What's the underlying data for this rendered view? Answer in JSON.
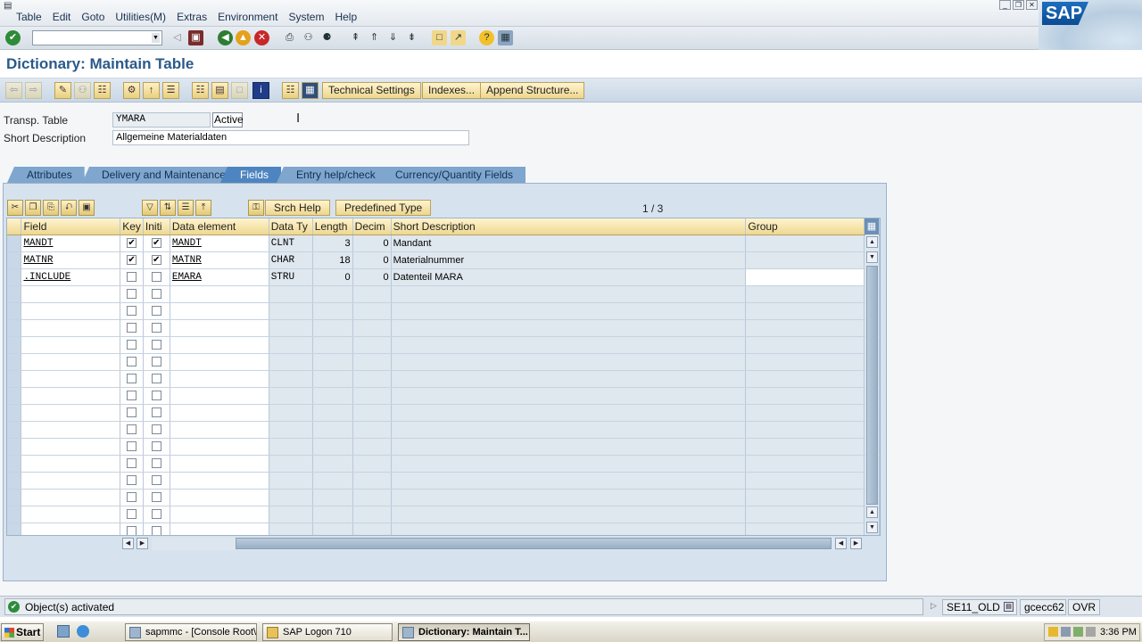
{
  "menubar": {
    "items": [
      "Table",
      "Edit",
      "Goto",
      "Utilities(M)",
      "Extras",
      "Environment",
      "System",
      "Help"
    ]
  },
  "brand": {
    "logo_text": "SAP"
  },
  "title": "Dictionary: Maintain Table",
  "app_toolbar": {
    "technical_settings": "Technical Settings",
    "indexes": "Indexes...",
    "append_structure": "Append Structure..."
  },
  "header": {
    "transp_table_label": "Transp. Table",
    "transp_table_value": "YMARA",
    "status": "Active",
    "short_desc_label": "Short Description",
    "short_desc_value": "Allgemeine Materialdaten"
  },
  "tabs": [
    {
      "label": "Attributes",
      "active": false
    },
    {
      "label": "Delivery and Maintenance",
      "active": false
    },
    {
      "label": "Fields",
      "active": true
    },
    {
      "label": "Entry help/check",
      "active": false
    },
    {
      "label": "Currency/Quantity Fields",
      "active": false
    }
  ],
  "grid_toolbar": {
    "srch_help": "Srch Help",
    "predefined_type": "Predefined Type",
    "page_indicator": "1  /  3"
  },
  "grid": {
    "columns": [
      "Field",
      "Key",
      "Initi",
      "Data element",
      "Data Ty",
      "Length",
      "Decim",
      "Short Description",
      "Group"
    ],
    "rows": [
      {
        "field": "MANDT",
        "key": true,
        "initial": true,
        "data_element": "MANDT",
        "data_type": "CLNT",
        "length": "3",
        "decimals": "0",
        "short_description": "Mandant",
        "group": ""
      },
      {
        "field": "MATNR",
        "key": true,
        "initial": true,
        "data_element": "MATNR",
        "data_type": "CHAR",
        "length": "18",
        "decimals": "0",
        "short_description": "Materialnummer",
        "group": ""
      },
      {
        "field": ".INCLUDE",
        "key": false,
        "initial": false,
        "data_element": "EMARA",
        "data_type": "STRU",
        "length": "0",
        "decimals": "0",
        "short_description": "Datenteil MARA",
        "group": ""
      }
    ],
    "empty_rows": 15
  },
  "statusbar": {
    "message": "Object(s) activated",
    "transaction": "SE11_OLD",
    "server": "gcecc62",
    "mode": "OVR"
  },
  "taskbar": {
    "start": "Start",
    "tasks": [
      {
        "label": "sapmmc - [Console Root\\...",
        "active": false
      },
      {
        "label": "SAP Logon 710",
        "active": false
      },
      {
        "label": "Dictionary: Maintain T...",
        "active": true
      }
    ],
    "clock": "3:36 PM"
  },
  "colors": {
    "title_blue": "#2a5a8a",
    "tab_active": "#4e85c0",
    "tab_inactive": "#7ea6cf",
    "button_gold": "#edd68e"
  },
  "icons": [
    "enter-icon",
    "save-icon",
    "back-icon",
    "exit-icon",
    "cancel-icon",
    "print-icon",
    "find-icon",
    "help-icon",
    "layout-icon"
  ]
}
